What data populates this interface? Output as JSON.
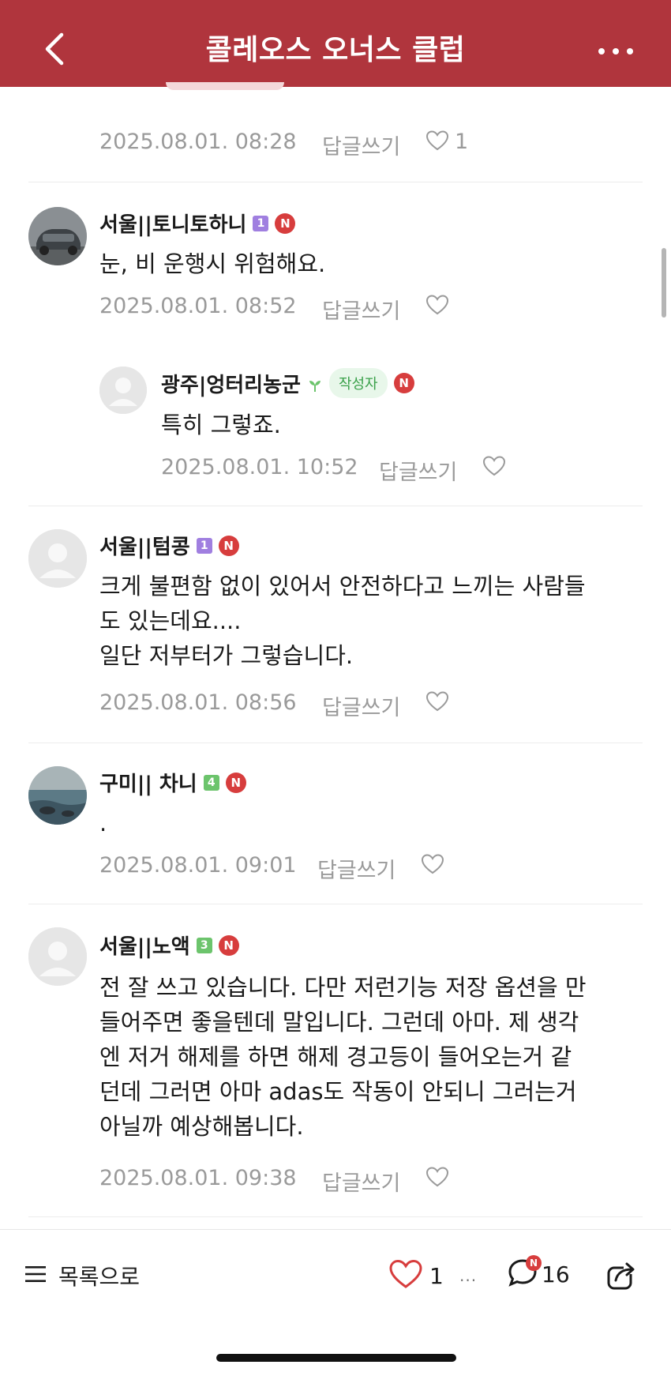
{
  "header": {
    "title": "콜레오스 오너스 클럽",
    "background": "#b0353d"
  },
  "top_meta": {
    "date": "2025.08.01. 08:28",
    "reply_label": "답글쓰기",
    "like_count": "1"
  },
  "comments": [
    {
      "author": "서울||토니토하니",
      "level": "1",
      "new_badge": "N",
      "text": "눈, 비 운행시 위험해요.",
      "date": "2025.08.01. 08:52",
      "reply_label": "답글쓰기"
    },
    {
      "author": "광주|엉터리농군",
      "author_tag": "작성자",
      "new_badge": "N",
      "text": "특히 그렇죠.",
      "date": "2025.08.01. 10:52",
      "reply_label": "답글쓰기"
    },
    {
      "author": "서울||텀콩",
      "level": "1",
      "new_badge": "N",
      "lines": [
        "크게 불편함 없이 있어서 안전하다고 느끼는 사람들",
        "도 있는데요....",
        "일단 저부터가 그렇습니다."
      ],
      "date": "2025.08.01. 08:56",
      "reply_label": "답글쓰기"
    },
    {
      "author": "구미|| 차니",
      "level": "4",
      "new_badge": "N",
      "text": ".",
      "date": "2025.08.01. 09:01",
      "reply_label": "답글쓰기"
    },
    {
      "author": "서울||노액",
      "level": "3",
      "new_badge": "N",
      "lines": [
        "전 잘 쓰고 있습니다. 다만 저런기능 저장 옵션을 만",
        "들어주면 좋을텐데 말입니다. 그런데 아마. 제 생각",
        "엔 저거 해제를 하면 해제 경고등이 들어오는거 같",
        "던데 그러면 아마 adas도 작동이 안되니 그러는거",
        "아닐까 예상해봅니다."
      ],
      "date": "2025.08.01. 09:38",
      "reply_label": "답글쓰기"
    }
  ],
  "bottom_bar": {
    "list_label": "목록으로",
    "like_count": "1",
    "more": "···",
    "comment_count": "16",
    "comment_badge": "N"
  },
  "colors": {
    "accent": "#b0353d",
    "new_badge": "#d73d3d",
    "level_1": "#a07fe0",
    "level_3": "#6cc46c",
    "level_4": "#6cc46c",
    "author_tag_bg": "#e8f7ea",
    "author_tag_text": "#3aa14a"
  }
}
